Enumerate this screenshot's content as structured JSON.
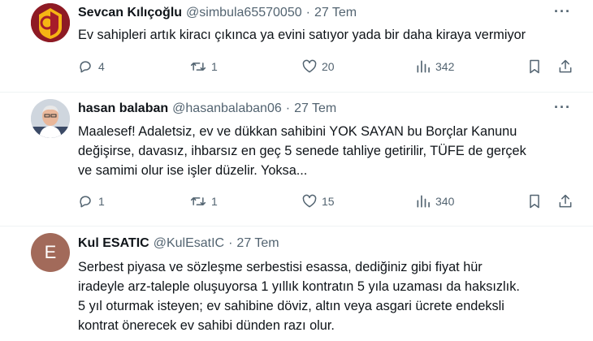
{
  "colors": {
    "text": "#0f1419",
    "muted": "#536471",
    "divider": "#eff3f4",
    "avatar_e": "#a26a5a"
  },
  "tweets": [
    {
      "name": "Sevcan Kılıçoğlu",
      "handle": "@simbula65570050",
      "dot": "·",
      "date": "27 Tem",
      "more": "···",
      "avatar_icon": "galatasaray-logo-icon",
      "lines": [
        "Ev sahipleri artık kiracı çıkınca ya evini satıyor yada bir daha kiraya vermiyor"
      ],
      "replies": "4",
      "retweets": "1",
      "likes": "20",
      "views": "342"
    },
    {
      "name": "hasan balaban",
      "handle": "@hasanbalaban06",
      "dot": "·",
      "date": "27 Tem",
      "more": "···",
      "avatar_icon": "profile-photo-icon",
      "lines": [
        "Maalesef! Adaletsiz, ev ve dükkan sahibini YOK SAYAN  bu Borçlar Kanunu",
        "değişirse, davasız,  ihbarsız en geç 5 senede tahliye getirilir, TÜFE de gerçek",
        "ve samimi olur ise işler düzelir. Yoksa..."
      ],
      "replies": "1",
      "retweets": "1",
      "likes": "15",
      "views": "340"
    },
    {
      "name": "Kul ESATIC",
      "handle": "@KulEsatIC",
      "dot": "·",
      "date": "27 Tem",
      "avatar_letter": "E",
      "lines": [
        "Serbest piyasa ve sözleşme serbestisi esassa, dediğiniz gibi fiyat hür",
        "iradeyle arz-taleple oluşuyorsa 1 yıllık kontratın 5 yıla uzaması da haksızlık.",
        "5 yıl oturmak isteyen; ev sahibine döviz, altın veya asgari ücrete endeksli",
        "kontrat önerecek ev sahibi dünden razı olur."
      ]
    }
  ]
}
